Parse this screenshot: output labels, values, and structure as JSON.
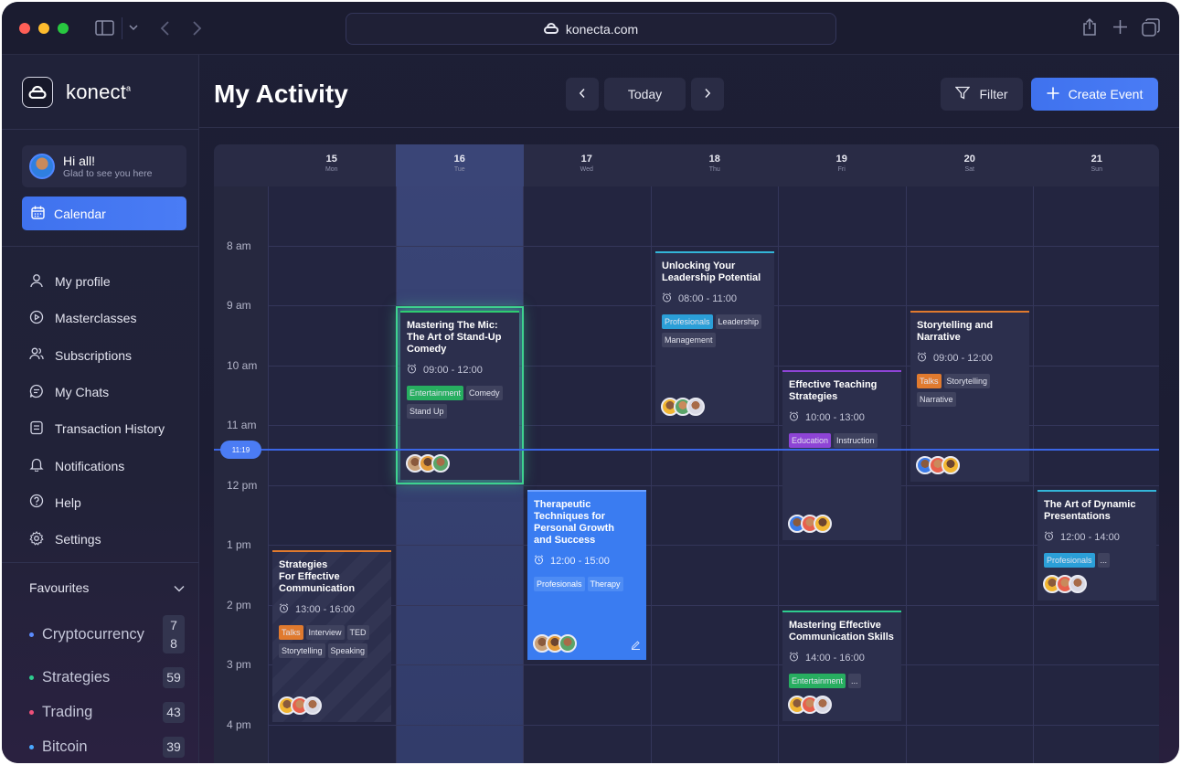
{
  "browser": {
    "url": "konecta.com"
  },
  "brand": {
    "name": "konect",
    "mark": "a"
  },
  "user": {
    "greeting": "Hi all!",
    "subtitle": "Glad to see you here"
  },
  "sidebar": {
    "active": "Calendar",
    "items": [
      {
        "label": "My profile",
        "icon": "user-icon"
      },
      {
        "label": "Masterclasses",
        "icon": "play-circle-icon"
      },
      {
        "label": "Subscriptions",
        "icon": "users-icon"
      },
      {
        "label": "My Chats",
        "icon": "chat-icon"
      },
      {
        "label": "Transaction History",
        "icon": "receipt-icon"
      },
      {
        "label": "Notifications",
        "icon": "bell-icon"
      },
      {
        "label": "Help",
        "icon": "help-icon"
      },
      {
        "label": "Settings",
        "icon": "gear-icon"
      }
    ],
    "favourites_label": "Favourites",
    "favourites": [
      {
        "label": "Cryptocurrency",
        "count": "7\n8",
        "color": "#5b8cff"
      },
      {
        "label": "Strategies",
        "count": "59",
        "color": "#2ecc8f"
      },
      {
        "label": "Trading",
        "count": "43",
        "color": "#f0507a"
      },
      {
        "label": "Bitcoin",
        "count": "39",
        "color": "#4aa8ff"
      }
    ]
  },
  "header": {
    "title": "My Activity",
    "today_label": "Today",
    "filter_label": "Filter",
    "create_label": "Create Event"
  },
  "calendar": {
    "days": [
      {
        "num": "15",
        "name": "Mon"
      },
      {
        "num": "16",
        "name": "Tue"
      },
      {
        "num": "17",
        "name": "Wed"
      },
      {
        "num": "18",
        "name": "Thu"
      },
      {
        "num": "19",
        "name": "Fri"
      },
      {
        "num": "20",
        "name": "Sat"
      },
      {
        "num": "21",
        "name": "Sun"
      }
    ],
    "hours": [
      "8 am",
      "9 am",
      "10 am",
      "11 am",
      "12 pm",
      "1 pm",
      "2 pm",
      "3 pm",
      "4 pm"
    ],
    "now": "11:19"
  },
  "events": [
    {
      "title": "Strategies\nFor Effective\nCommunication",
      "time": "13:00 - 16:00",
      "tags": [
        {
          "t": "Talks",
          "c": "#e07a2e"
        },
        {
          "t": "Interview"
        },
        {
          "t": "TED"
        },
        {
          "t": "Storytelling"
        },
        {
          "t": "Speaking"
        }
      ]
    },
    {
      "title": "Mastering The Mic:\nThe Art of Stand-Up\nComedy",
      "time": "09:00 - 12:00",
      "tags": [
        {
          "t": "Entertainment",
          "c": "#27ae60"
        },
        {
          "t": "Comedy"
        },
        {
          "t": "Stand Up"
        }
      ]
    },
    {
      "title": "Therapeutic\nTechniques for\nPersonal Growth\nand Success",
      "time": "12:00 - 15:00",
      "tags": [
        {
          "t": "Profesionals"
        },
        {
          "t": "Therapy"
        }
      ]
    },
    {
      "title": "Unlocking Your\nLeadership Potential",
      "time": "08:00 - 11:00",
      "tags": [
        {
          "t": "Profesionals",
          "c": "#2b9fd8"
        },
        {
          "t": "Leadership"
        },
        {
          "t": "Management"
        }
      ]
    },
    {
      "title": "Effective Teaching\nStrategies",
      "time": "10:00 - 13:00",
      "tags": [
        {
          "t": "Education",
          "c": "#8e44d6"
        },
        {
          "t": "Instruction"
        }
      ]
    },
    {
      "title": "Mastering Effective\nCommunication Skills",
      "time": "14:00 - 16:00",
      "tags": [
        {
          "t": "Entertainment",
          "c": "#27ae60"
        },
        {
          "t": "..."
        }
      ]
    },
    {
      "title": "Storytelling and\nNarrative",
      "time": "09:00 - 12:00",
      "tags": [
        {
          "t": "Talks",
          "c": "#e07a2e"
        },
        {
          "t": "Storytelling"
        },
        {
          "t": "Narrative"
        }
      ]
    },
    {
      "title": "The Art of Dynamic\nPresentations",
      "time": "12:00 - 14:00",
      "tags": [
        {
          "t": "Profesionals",
          "c": "#2b9fd8"
        },
        {
          "t": "..."
        }
      ]
    }
  ],
  "colors": {
    "accent": "#4a7cf5",
    "selected_glow": "#3ed28f",
    "now_line": "#3b66e6"
  }
}
